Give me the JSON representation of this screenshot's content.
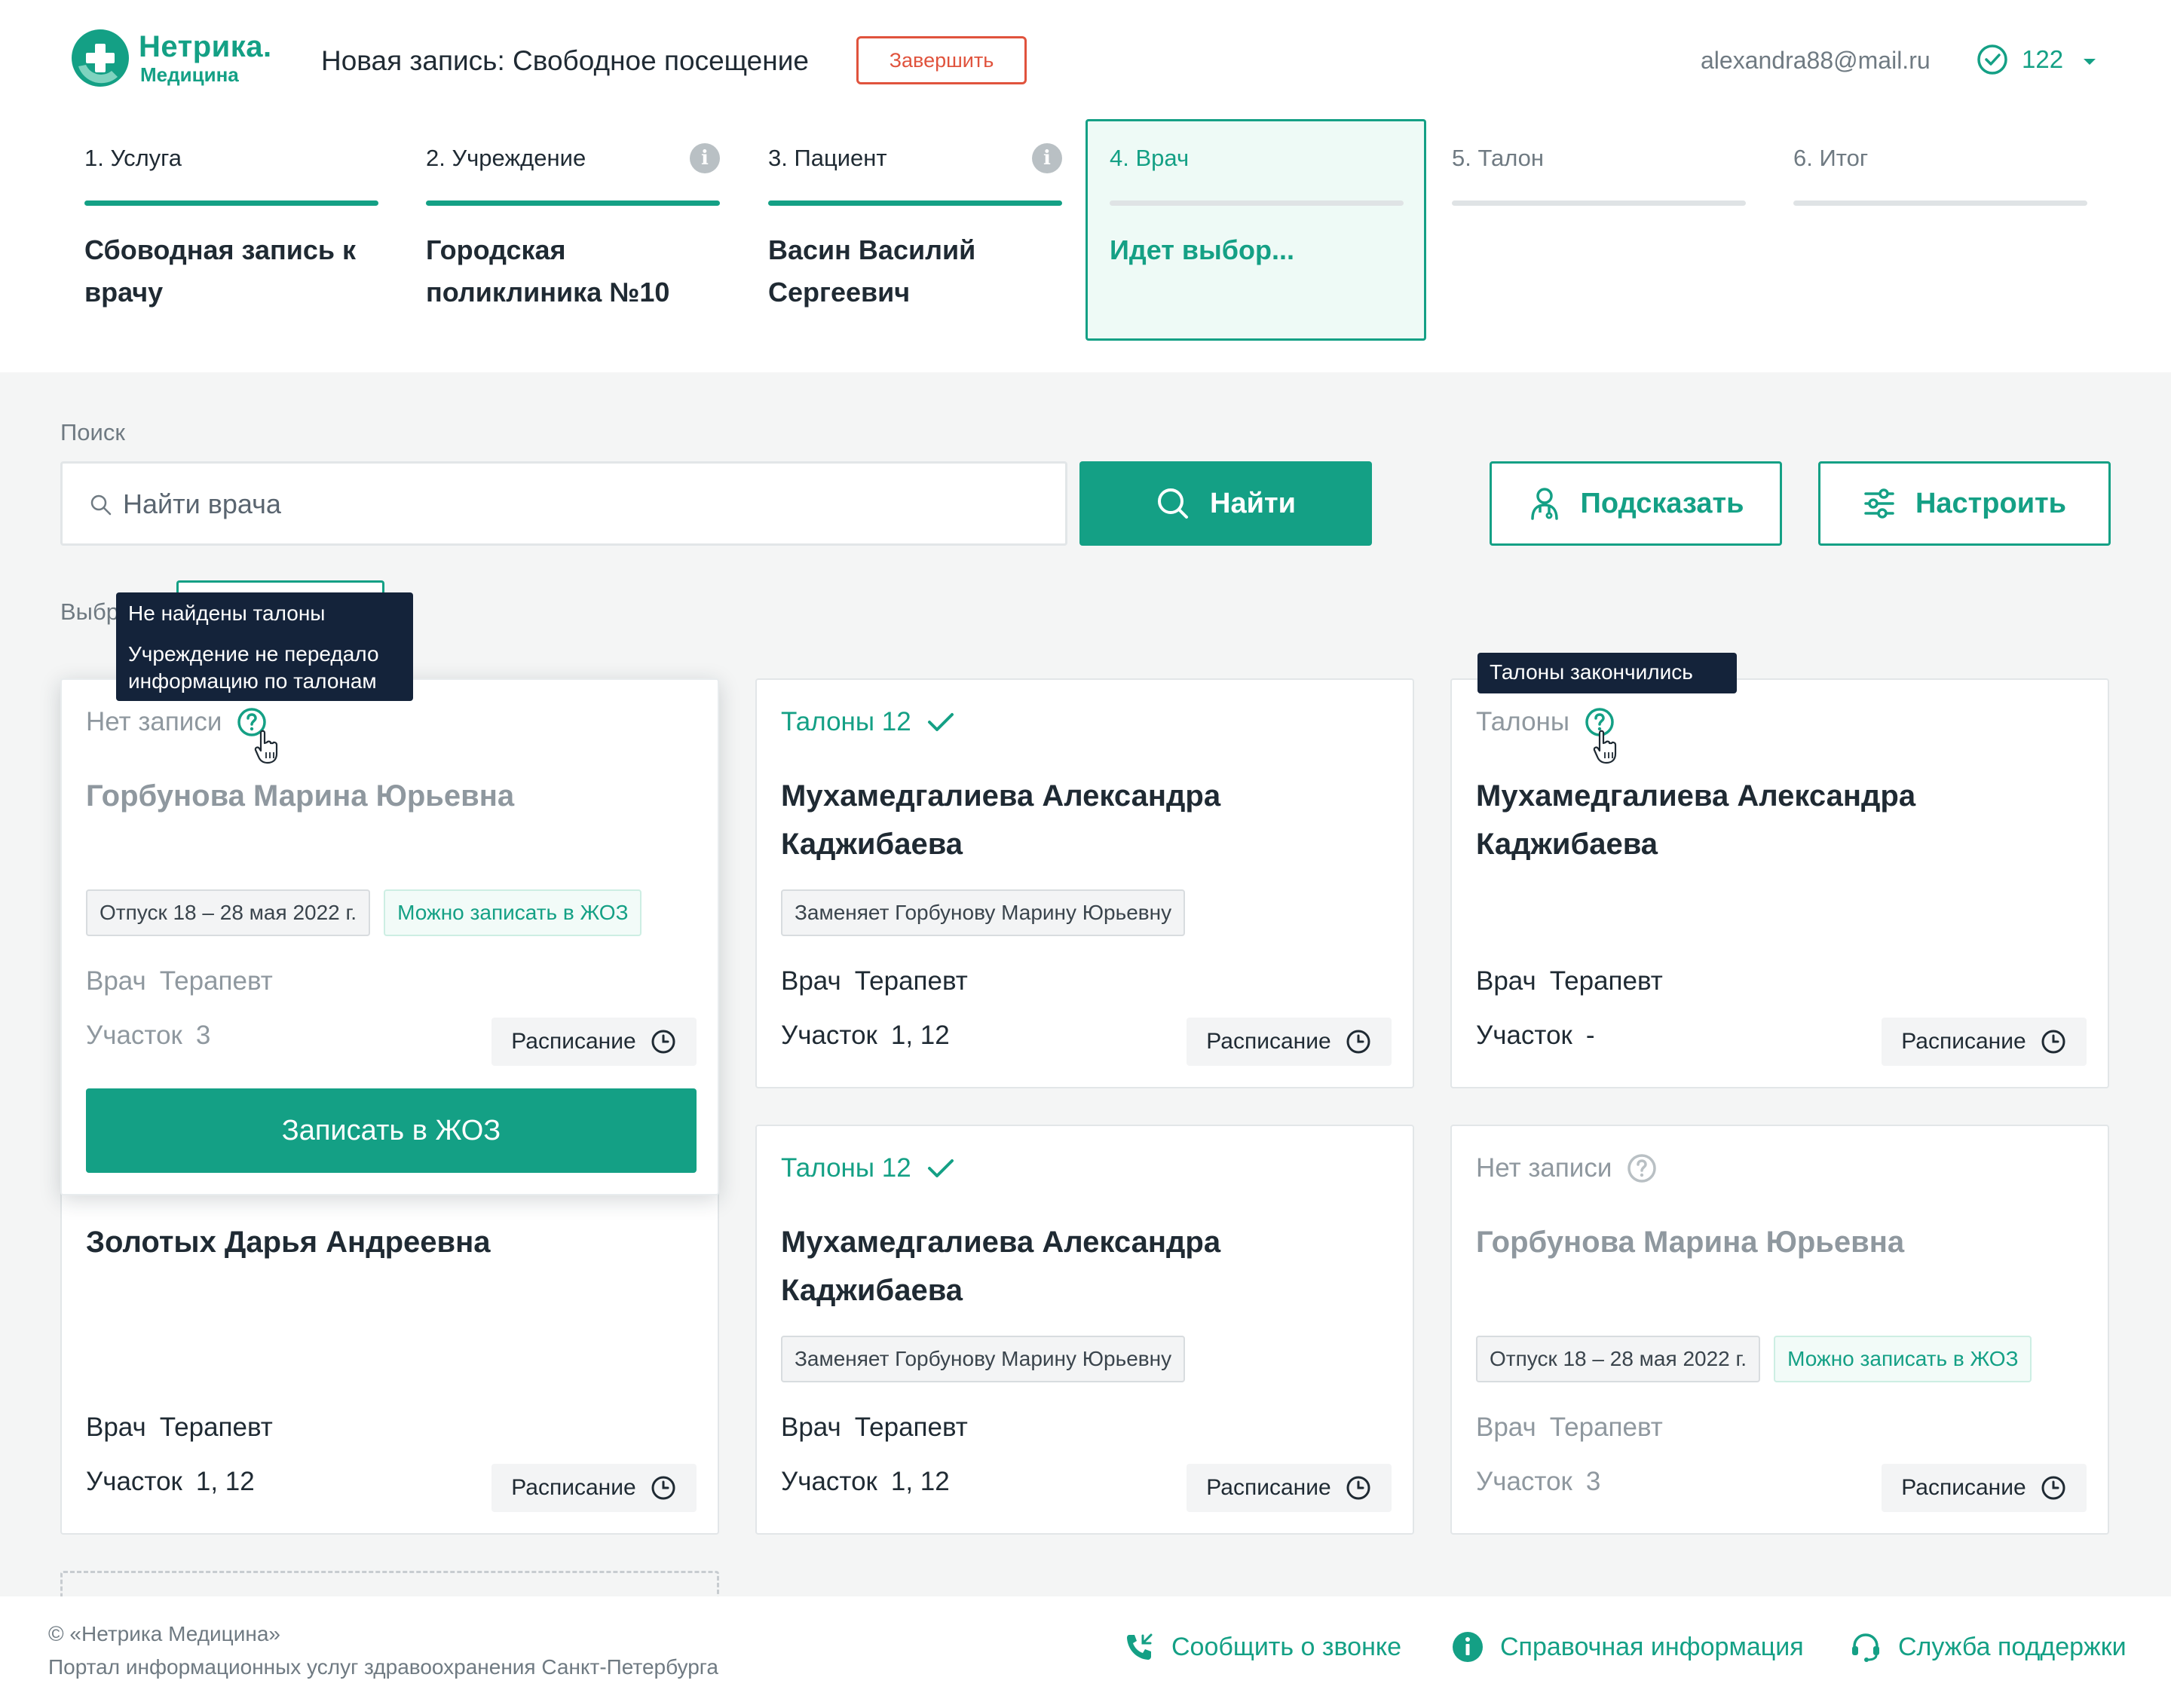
{
  "brand": {
    "name": "Нетрика.",
    "subname": "Медицина"
  },
  "header": {
    "title": "Новая запись: Свободное посещение",
    "finish_label": "Завершить",
    "email": "alexandra88@mail.ru",
    "points": "122"
  },
  "steps": [
    {
      "label": "1. Услуга",
      "value": "Сбоводная запись к врачу",
      "state": "done"
    },
    {
      "label": "2. Учреждение",
      "value": "Городская поликлиника №10",
      "state": "done",
      "info": "i"
    },
    {
      "label": "3. Пациент",
      "value": "Васин Василий Сергеевич",
      "state": "done",
      "info": "i"
    },
    {
      "label": "4. Врач",
      "value": "Идет выбор...",
      "state": "active"
    },
    {
      "label": "5. Талон",
      "value": "",
      "state": "pending"
    },
    {
      "label": "6. Итог",
      "value": "",
      "state": "pending"
    }
  ],
  "search": {
    "label": "Поиск",
    "placeholder": "Найти врача",
    "find_label": "Найти",
    "hint_label": "Подсказать",
    "tune_label": "Настроить"
  },
  "select_label": "Выбр",
  "tooltips": {
    "no_tickets_title": "Не найдены талоны",
    "no_tickets_text_1": "Учреждение не передало",
    "no_tickets_text_2": "информацию по талонам",
    "tickets_over": "Талоны закончились"
  },
  "cards": [
    {
      "status": "Нет записи",
      "name": "Горбунова Марина Юрьевна",
      "tags": [
        "Отпуск 18 – 28 мая 2022 г.",
        "Можно записать в ЖОЗ"
      ],
      "role_label": "Врач",
      "role": "Терапевт",
      "area_label": "Участок",
      "area": "3",
      "schedule_label": "Расписание",
      "enroll_label": "Записать в ЖОЗ"
    },
    {
      "status": "Талоны 12",
      "name": "Мухамедгалиева Александра Каджибаева",
      "tags": [
        "Заменяет Горбунову Марину Юрьевну"
      ],
      "role_label": "Врач",
      "role": "Терапевт",
      "area_label": "Участок",
      "area": "1, 12",
      "schedule_label": "Расписание"
    },
    {
      "status": "Талоны",
      "name": "Мухамедгалиева Александра Каджибаева",
      "role_label": "Врач",
      "role": "Терапевт",
      "area_label": "Участок",
      "area": "-",
      "schedule_label": "Расписание"
    },
    {
      "name": "Золотых Дарья Андреевна",
      "role_label": "Врач",
      "role": "Терапевт",
      "area_label": "Участок",
      "area": "1, 12",
      "schedule_label": "Расписание"
    },
    {
      "status": "Талоны 12",
      "name": "Мухамедгалиева Александра Каджибаева",
      "tags": [
        "Заменяет Горбунову Марину Юрьевну"
      ],
      "role_label": "Врач",
      "role": "Терапевт",
      "area_label": "Участок",
      "area": "1, 12",
      "schedule_label": "Расписание"
    },
    {
      "status": "Нет записи",
      "name": "Горбунова Марина Юрьевна",
      "tags": [
        "Отпуск 18 – 28 мая 2022 г.",
        "Можно записать в ЖОЗ"
      ],
      "role_label": "Врач",
      "role": "Терапевт",
      "area_label": "Участок",
      "area": "3",
      "schedule_label": "Расписание"
    }
  ],
  "footer": {
    "copyright": "© «Нетрика Медицина»",
    "portal": "Портал информационных услуг здравоохранения Санкт-Петербурга",
    "call_label": "Сообщить о звонке",
    "info_label": "Справочная информация",
    "support_label": "Служба поддержки"
  },
  "colors": {
    "accent": "#14a085",
    "danger": "#e0533d",
    "tooltip": "#14233a",
    "muted": "#8f989f"
  },
  "icons": [
    "logo-icon",
    "check-circle-icon",
    "chevron-down-icon",
    "info-icon",
    "search-icon",
    "doctor-icon",
    "sliders-icon",
    "question-icon",
    "check-icon",
    "clock-icon",
    "cursor-hand-icon",
    "phone-icon",
    "headset-icon"
  ]
}
